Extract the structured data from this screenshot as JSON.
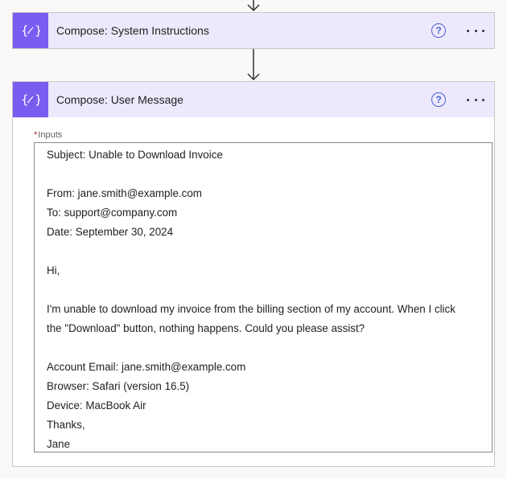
{
  "actions": [
    {
      "title": "Compose: System Instructions",
      "icon": "compose-icon",
      "help_label": "?",
      "accent_color": "#7a5cf0"
    },
    {
      "title": "Compose: User Message",
      "icon": "compose-icon",
      "help_label": "?",
      "accent_color": "#7a5cf0",
      "inputs": {
        "label": "Inputs",
        "required_marker": "*",
        "lines": [
          "Subject: Unable to Download Invoice",
          "",
          "From: jane.smith@example.com",
          "To: support@company.com",
          "Date: September 30, 2024",
          "",
          "Hi,",
          "",
          "I'm unable to download my invoice from the billing section of my account. When I click",
          "the \"Download\" button, nothing happens. Could you please assist?",
          "",
          "Account Email: jane.smith@example.com",
          "Browser: Safari (version 16.5)",
          "Device: MacBook Air",
          "Thanks,",
          "Jane"
        ]
      }
    }
  ],
  "colors": {
    "header_bg": "#ede8fb",
    "help_icon": "#4a63d9",
    "required": "#a4262c"
  }
}
